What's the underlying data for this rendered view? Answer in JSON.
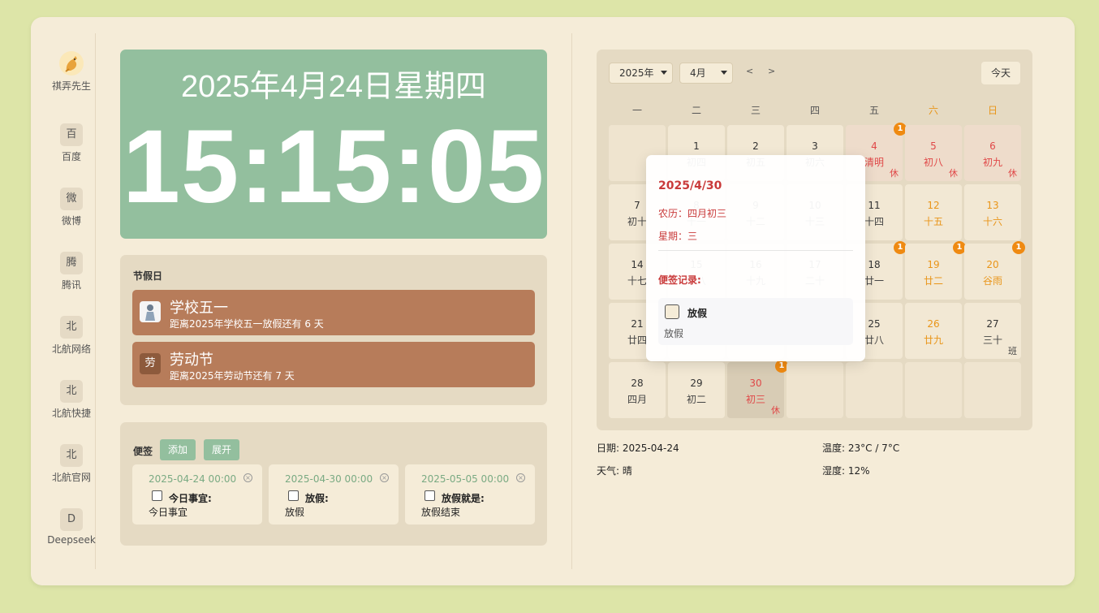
{
  "sidebar": {
    "items": [
      {
        "label": "祺弄先生",
        "icon": "dragon-avatar-icon"
      },
      {
        "label": "百度",
        "glyph": "百"
      },
      {
        "label": "微博",
        "glyph": "微"
      },
      {
        "label": "腾讯",
        "glyph": "腾"
      },
      {
        "label": "北航网络",
        "glyph": "北"
      },
      {
        "label": "北航快捷",
        "glyph": "北"
      },
      {
        "label": "北航官网",
        "glyph": "北"
      },
      {
        "label": "Deepseek",
        "glyph": "D"
      }
    ]
  },
  "clock": {
    "date": "2025年4月24日星期四",
    "time": "15:15:05"
  },
  "holidays": {
    "title": "节假日",
    "items": [
      {
        "name": "学校五一",
        "sub": "距离2025年学校五一放假还有 6 天",
        "icon": "student-image-icon"
      },
      {
        "name": "劳动节",
        "sub": "距离2025年劳动节还有 7 天",
        "glyph": "劳"
      }
    ]
  },
  "notes": {
    "title": "便签",
    "add_label": "添加",
    "expand_label": "展开",
    "items": [
      {
        "date": "2025-04-24 00:00",
        "title": "今日事宜:",
        "body": "今日事宜"
      },
      {
        "date": "2025-04-30 00:00",
        "title": "放假:",
        "body": "放假"
      },
      {
        "date": "2025-05-05 00:00",
        "title": "放假就是:",
        "body": "放假结束"
      }
    ]
  },
  "calendar": {
    "year_select": "2025年",
    "month_select": "4月",
    "prev": "<",
    "next": ">",
    "today_label": "今天",
    "weekdays": [
      "一",
      "二",
      "三",
      "四",
      "五",
      "六",
      "日"
    ],
    "weeks": [
      [
        null,
        {
          "d": "1",
          "l": "初四"
        },
        {
          "d": "2",
          "l": "初五"
        },
        {
          "d": "3",
          "l": "初六"
        },
        {
          "d": "4",
          "l": "清明",
          "tag": "休",
          "badge": "1",
          "style": "red",
          "bg": "holiday"
        },
        {
          "d": "5",
          "l": "初八",
          "tag": "休",
          "style": "red",
          "bg": "holiday"
        },
        {
          "d": "6",
          "l": "初九",
          "tag": "休",
          "style": "red",
          "bg": "holiday"
        }
      ],
      [
        {
          "d": "7",
          "l": "初十"
        },
        {
          "d": "8",
          "l": "十一"
        },
        {
          "d": "9",
          "l": "十二"
        },
        {
          "d": "10",
          "l": "十三"
        },
        {
          "d": "11",
          "l": "十四"
        },
        {
          "d": "12",
          "l": "十五",
          "style": "orange"
        },
        {
          "d": "13",
          "l": "十六",
          "style": "orange"
        }
      ],
      [
        {
          "d": "14",
          "l": "十七"
        },
        {
          "d": "15",
          "l": "十八"
        },
        {
          "d": "16",
          "l": "十九"
        },
        {
          "d": "17",
          "l": "二十"
        },
        {
          "d": "18",
          "l": "廿一",
          "badge": "1"
        },
        {
          "d": "19",
          "l": "廿二",
          "badge": "1",
          "style": "orange"
        },
        {
          "d": "20",
          "l": "谷雨",
          "badge": "1",
          "style": "orange"
        }
      ],
      [
        {
          "d": "21",
          "l": "廿四"
        },
        {
          "d": "22",
          "l": "廿五"
        },
        {
          "d": "23",
          "l": "廿六"
        },
        {
          "d": "24",
          "l": "廿七"
        },
        {
          "d": "25",
          "l": "廿八"
        },
        {
          "d": "26",
          "l": "廿九",
          "style": "orange"
        },
        {
          "d": "27",
          "l": "三十",
          "tag": "班",
          "tagStyle": "ban"
        }
      ],
      [
        {
          "d": "28",
          "l": "四月"
        },
        {
          "d": "29",
          "l": "初二"
        },
        {
          "d": "30",
          "l": "初三",
          "tag": "休",
          "badge": "1",
          "style": "red",
          "bg": "selected"
        },
        null,
        null,
        null,
        null
      ]
    ]
  },
  "weather": {
    "date": "日期: 2025-04-24",
    "temp": "温度: 23°C / 7°C",
    "weather": "天气: 晴",
    "humidity": "湿度: 12%"
  },
  "popover": {
    "date": "2025/4/30",
    "lunar": "农历：四月初三",
    "weekday": "星期：三",
    "memo_title": "便签记录:",
    "item_title": "放假",
    "item_body": "放假"
  }
}
